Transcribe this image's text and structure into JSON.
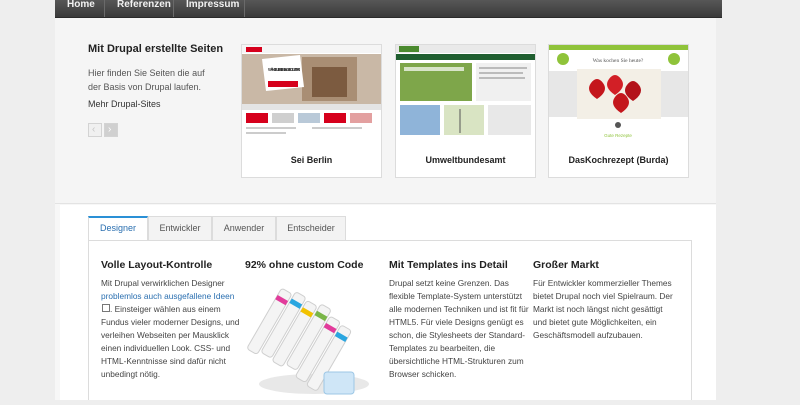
{
  "nav": {
    "items": [
      "Home",
      "Referenzen",
      "Impressum"
    ]
  },
  "showcase": {
    "title": "Mit Drupal erstellte Seiten",
    "description": "Hier finden Sie Seiten die auf der Basis von Drupal laufen.",
    "more_link": "Mehr Drupal-Sites",
    "prev_symbol": "‹",
    "next_symbol": "›",
    "cards": [
      {
        "label": "Sei Berlin",
        "overlay_text": "WÄHLT EUER LIEBLINGS-SOUVENIR!"
      },
      {
        "label": "Umweltbundesamt"
      },
      {
        "label": "DasKochrezept (Burda)",
        "header_text": "Was kochen Sie heute?",
        "footer_text": "Gute Rezepte"
      }
    ]
  },
  "tabs": {
    "items": [
      "Designer",
      "Entwickler",
      "Anwender",
      "Entscheider"
    ],
    "active": "Designer"
  },
  "columns": {
    "c1": {
      "title": "Volle Layout-Kontrolle",
      "text_before": "Mit Drupal verwirklichen Designer ",
      "link": "problemlos auch ausgefallene Ideen",
      "text_after": ". Einsteiger wählen aus einem Fundus vieler moderner Designs, und verleihen Webseiten per Mausklick einen individuellen Look. CSS- und HTML-Kenntnisse sind dafür nicht unbedingt nötig."
    },
    "c2": {
      "title": "92% ohne custom Code"
    },
    "c3": {
      "title": "Mit Templates ins Detail",
      "text": "Drupal setzt keine Grenzen. Das flexible Template-System unterstützt alle modernen Techniken und ist fit für HTML5. Für viele Designs genügt es schon, die Stylesheets der Standard-Templates zu bearbeiten, die übersichtliche HTML-Strukturen zum Browser schicken."
    },
    "c4": {
      "title": "Großer Markt",
      "text": "Für Entwickler kommerzieller Themes bietet Drupal noch viel Spielraum. Der Markt ist noch längst nicht gesättigt und bietet gute Möglichkeiten, ein Geschäftsmodell aufzubauen."
    }
  },
  "colors": {
    "accent": "#2a90d6",
    "link": "#2a6fb0",
    "nav": "#4a4a4a"
  }
}
